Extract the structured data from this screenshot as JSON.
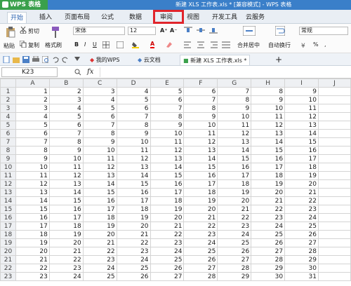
{
  "window": {
    "app_name": "WPS 表格",
    "title": "新建 XLS 工作表.xls * [兼容模式] - WPS 表格"
  },
  "menu_tabs": [
    "开始",
    "插入",
    "页面布局",
    "公式",
    "数据",
    "审阅",
    "视图",
    "开发工具",
    "云服务"
  ],
  "ribbon": {
    "paste": "粘贴",
    "cut": "剪切",
    "copy": "复制",
    "format_painter": "格式刷",
    "font_name": "宋体",
    "font_size": "12",
    "merge_center": "合并居中",
    "wrap_text": "自动换行",
    "number_format": "常规"
  },
  "doc_tabs": {
    "wps": "我的WPS",
    "cloud": "云文档",
    "file": "新建 XLS 工作表.xls *"
  },
  "formula_bar": {
    "cell_ref": "K23",
    "fx": "fx"
  },
  "sheet": {
    "columns": [
      "A",
      "B",
      "C",
      "D",
      "E",
      "F",
      "G",
      "H",
      "I",
      "J"
    ],
    "rows": [
      [
        1,
        2,
        3,
        4,
        5,
        6,
        7,
        8,
        9
      ],
      [
        2,
        3,
        4,
        5,
        6,
        7,
        8,
        9,
        10
      ],
      [
        3,
        4,
        5,
        6,
        7,
        8,
        9,
        10,
        11
      ],
      [
        4,
        5,
        6,
        7,
        8,
        9,
        10,
        11,
        12
      ],
      [
        5,
        6,
        7,
        8,
        9,
        10,
        11,
        12,
        13
      ],
      [
        6,
        7,
        8,
        9,
        10,
        11,
        12,
        13,
        14
      ],
      [
        7,
        8,
        9,
        10,
        11,
        12,
        13,
        14,
        15
      ],
      [
        8,
        9,
        10,
        11,
        12,
        13,
        14,
        15,
        16
      ],
      [
        9,
        10,
        11,
        12,
        13,
        14,
        15,
        16,
        17
      ],
      [
        10,
        11,
        12,
        13,
        14,
        15,
        16,
        17,
        18
      ],
      [
        11,
        12,
        13,
        14,
        15,
        16,
        17,
        18,
        19
      ],
      [
        12,
        13,
        14,
        15,
        16,
        17,
        18,
        19,
        20
      ],
      [
        13,
        14,
        15,
        16,
        17,
        18,
        19,
        20,
        21
      ],
      [
        14,
        15,
        16,
        17,
        18,
        19,
        20,
        21,
        22
      ],
      [
        15,
        16,
        17,
        18,
        19,
        20,
        21,
        22,
        23
      ],
      [
        16,
        17,
        18,
        19,
        20,
        21,
        22,
        23,
        24
      ],
      [
        17,
        18,
        19,
        20,
        21,
        22,
        23,
        24,
        25
      ],
      [
        18,
        19,
        20,
        21,
        22,
        23,
        24,
        25,
        26
      ],
      [
        19,
        20,
        21,
        22,
        23,
        24,
        25,
        26,
        27
      ],
      [
        20,
        21,
        22,
        23,
        24,
        25,
        26,
        27,
        28
      ],
      [
        21,
        22,
        23,
        24,
        25,
        26,
        27,
        28,
        29
      ],
      [
        22,
        23,
        24,
        25,
        26,
        27,
        28,
        29,
        30
      ],
      [
        23,
        24,
        25,
        26,
        27,
        28,
        29,
        30,
        31
      ]
    ]
  },
  "colors": {
    "accent": "#3a7fc9",
    "highlight": "#e0242b"
  }
}
